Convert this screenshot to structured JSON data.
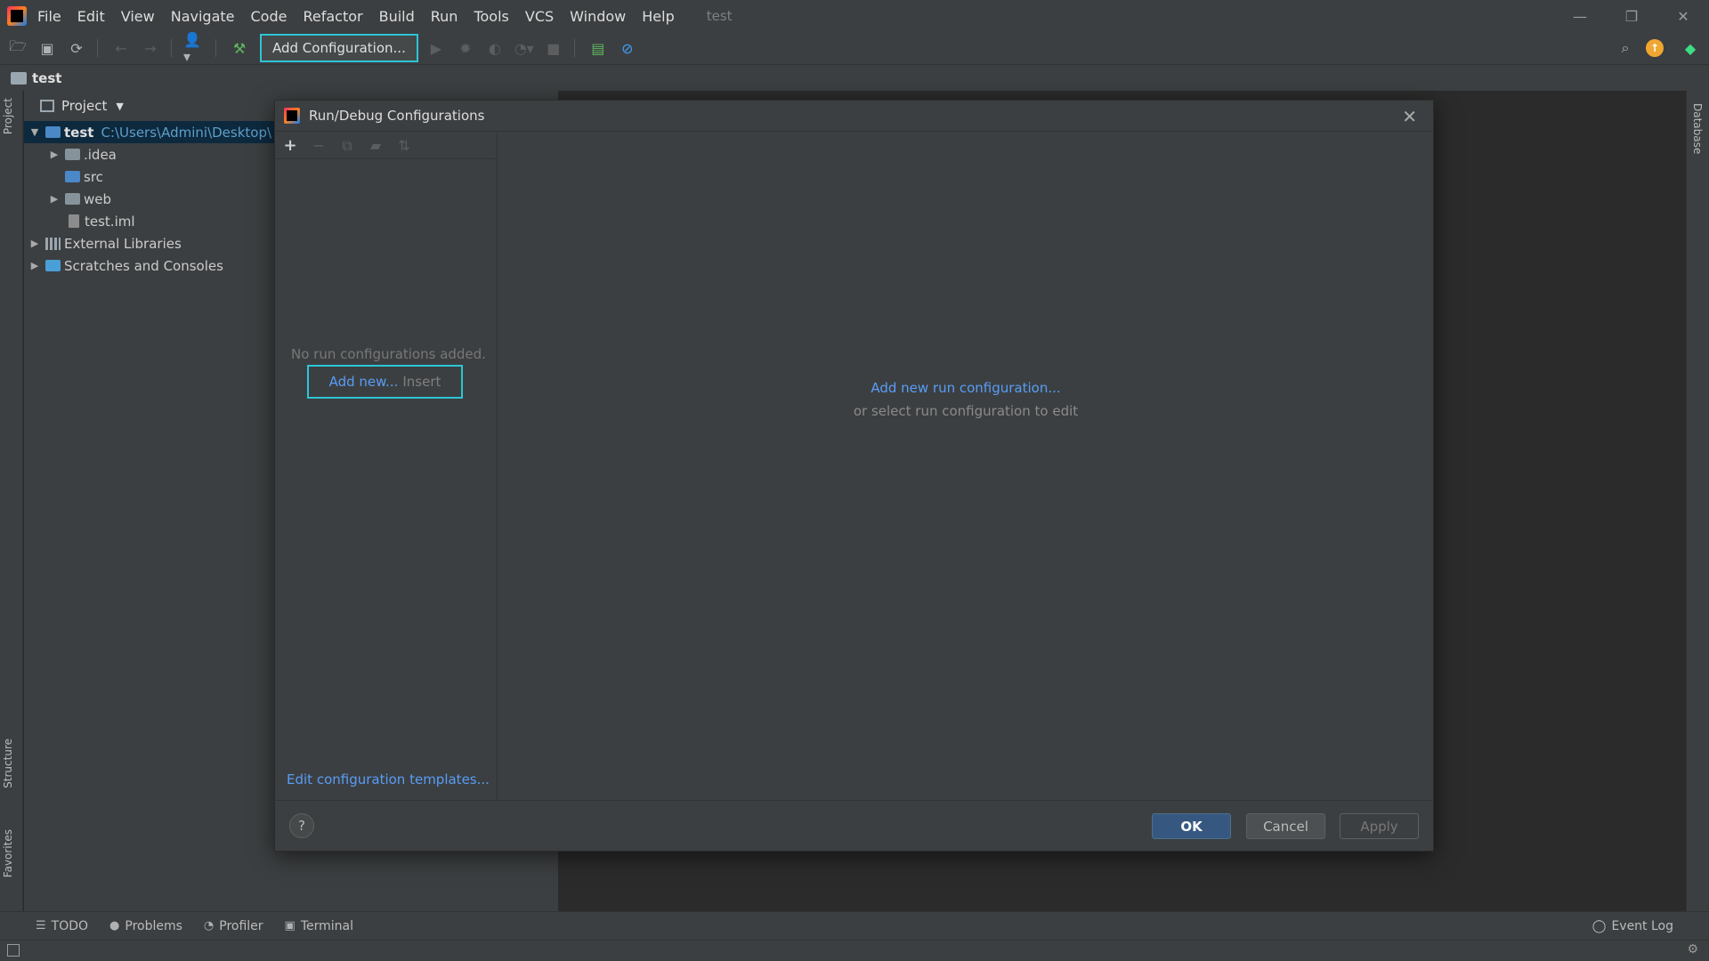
{
  "menubar": {
    "items": [
      "File",
      "Edit",
      "View",
      "Navigate",
      "Code",
      "Refactor",
      "Build",
      "Run",
      "Tools",
      "VCS",
      "Window",
      "Help"
    ],
    "window_title": "test"
  },
  "toolbar": {
    "run_config_label": "Add Configuration..."
  },
  "navbar": {
    "crumb": "test"
  },
  "side_tabs": {
    "project": "Project",
    "structure": "Structure",
    "favorites": "Favorites",
    "database": "Database"
  },
  "project_panel": {
    "header": "Project",
    "tree": [
      {
        "label": "test",
        "path": "C:\\Users\\Admini\\Desktop\\"
      },
      {
        "label": ".idea"
      },
      {
        "label": "src"
      },
      {
        "label": "web"
      },
      {
        "label": "test.iml"
      },
      {
        "label": "External Libraries"
      },
      {
        "label": "Scratches and Consoles"
      }
    ]
  },
  "dialog": {
    "title": "Run/Debug Configurations",
    "no_configs": "No run configurations added.",
    "add_new": "Add new...",
    "add_new_shortcut": "Insert",
    "edit_templates": "Edit configuration templates...",
    "add_run_config": "Add new run configuration...",
    "select_hint": "or select run configuration to edit",
    "help": "?",
    "ok": "OK",
    "cancel": "Cancel",
    "apply": "Apply"
  },
  "bottom_bar": {
    "todo": "TODO",
    "problems": "Problems",
    "profiler": "Profiler",
    "terminal": "Terminal",
    "event_log": "Event Log"
  },
  "colors": {
    "accent_highlight": "#2cc5d6",
    "link": "#589df6",
    "ok_button": "#365880"
  }
}
